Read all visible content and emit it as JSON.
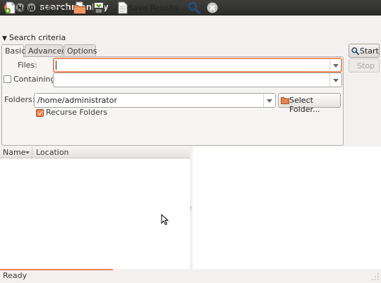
{
  "window": {
    "title": "searchmonkey"
  },
  "toolbar": {
    "new_instance": "New Instance",
    "save_results": "Save Results...",
    "icons": [
      "new-doc-icon",
      "open-folder-icon",
      "save-icon",
      "document-icon",
      "search-icon",
      "stop-icon"
    ]
  },
  "criteria": {
    "header": "Search criteria",
    "tabs": [
      "Basic",
      "Advanced",
      "Options"
    ],
    "active_tab": "Basic",
    "files_label": "Files:",
    "files_value": "",
    "containing_label": "Containing:",
    "containing_checked": false,
    "containing_value": "",
    "folders_label": "Folders:",
    "folders_value": "/home/administrator",
    "select_folder": "Select Folder...",
    "recurse_label": "Recurse Folders",
    "recurse_checked": true
  },
  "actions": {
    "start": "Start",
    "stop": "Stop",
    "stop_enabled": false
  },
  "results": {
    "columns": [
      "Name",
      "Location"
    ],
    "rows": []
  },
  "status": {
    "text": "Ready"
  },
  "colors": {
    "accent": "#e8834e",
    "titlebar": "#3e3e3b",
    "background": "#f2f1f0"
  }
}
